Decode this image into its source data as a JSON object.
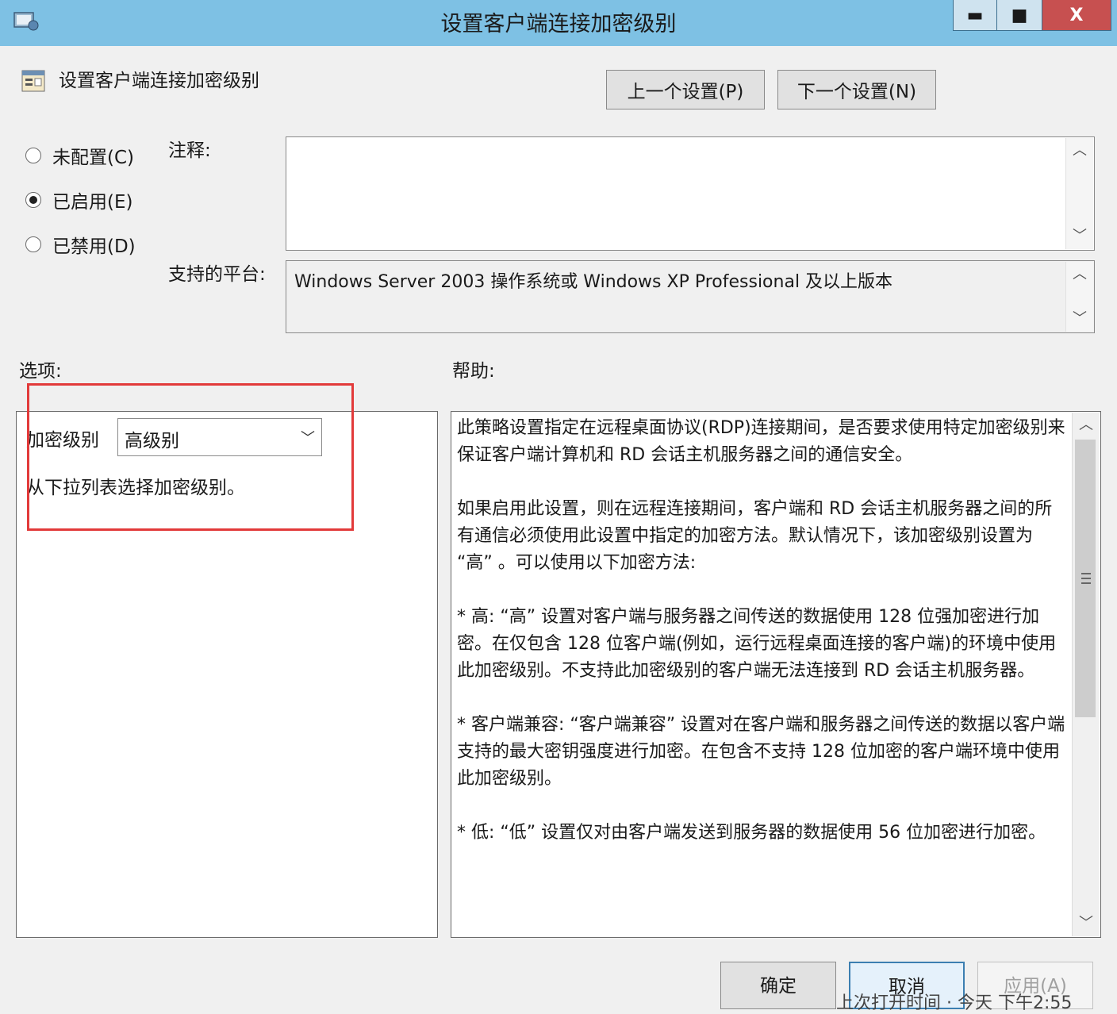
{
  "window": {
    "title": "设置客户端连接加密级别",
    "minimize_glyph": "▬",
    "maximize_glyph": "■",
    "close_glyph": "X"
  },
  "header": {
    "setting_title": "设置客户端连接加密级别",
    "prev_label": "上一个设置(P)",
    "next_label": "下一个设置(N)"
  },
  "state": {
    "options": [
      {
        "label": "未配置(C)",
        "selected": false
      },
      {
        "label": "已启用(E)",
        "selected": true
      },
      {
        "label": "已禁用(D)",
        "selected": false
      }
    ]
  },
  "comment": {
    "label": "注释:",
    "value": ""
  },
  "platform": {
    "label": "支持的平台:",
    "value": "Windows Server 2003 操作系统或 Windows XP Professional 及以上版本"
  },
  "options_section": {
    "label": "选项:",
    "encryption_label": "加密级别",
    "encryption_value": "高级别",
    "hint": "从下拉列表选择加密级别。"
  },
  "help_section": {
    "label": "帮助:",
    "text": "此策略设置指定在远程桌面协议(RDP)连接期间，是否要求使用特定加密级别来保证客户端计算机和 RD 会话主机服务器之间的通信安全。\n\n如果启用此设置，则在远程连接期间，客户端和 RD 会话主机服务器之间的所有通信必须使用此设置中指定的加密方法。默认情况下，该加密级别设置为 “高” 。可以使用以下加密方法:\n\n* 高: “高” 设置对客户端与服务器之间传送的数据使用 128 位强加密进行加密。在仅包含 128 位客户端(例如，运行远程桌面连接的客户端)的环境中使用此加密级别。不支持此加密级别的客户端无法连接到 RD 会话主机服务器。\n\n* 客户端兼容: “客户端兼容” 设置对在客户端和服务器之间传送的数据以客户端支持的最大密钥强度进行加密。在包含不支持 128 位加密的客户端环境中使用此加密级别。\n\n* 低: “低” 设置仅对由客户端发送到服务器的数据使用 56 位加密进行加密。"
  },
  "footer": {
    "ok_label": "确定",
    "cancel_label": "取消",
    "apply_label": "应用(A)"
  },
  "background_text": "上次打开时间 · 今天 下午2:55",
  "icons": {
    "up_arrow": "︿",
    "down_arrow": "﹀",
    "combo_arrow": "﹀"
  },
  "colors": {
    "titlebar": "#7ec1e4",
    "close_button": "#c75050",
    "highlight_box": "#e23a3a"
  }
}
